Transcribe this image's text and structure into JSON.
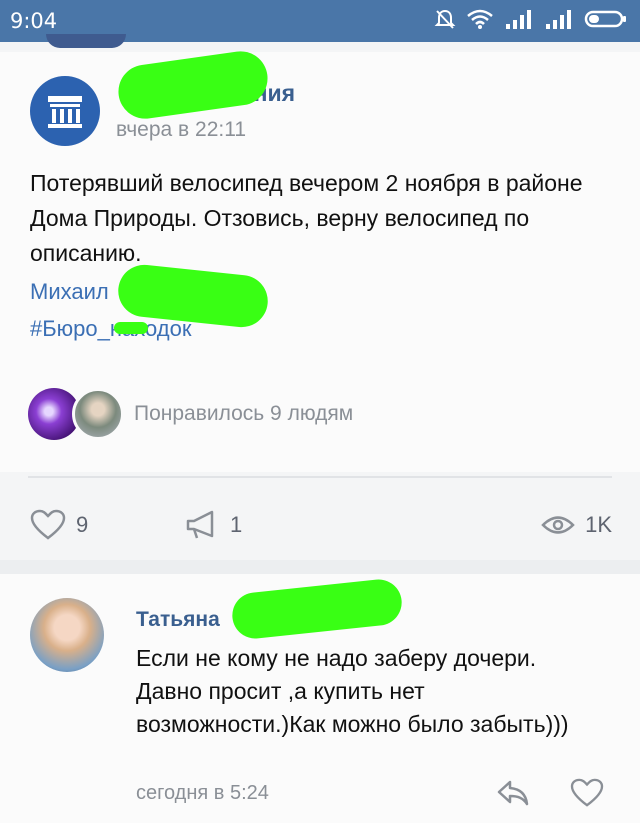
{
  "status_bar": {
    "time": "9:04",
    "icons": [
      "mute-bell-icon",
      "wifi-icon",
      "signal-icon",
      "signal-icon",
      "battery-icon"
    ]
  },
  "post": {
    "author": "к | Объявления",
    "time": "вчера в 22:11",
    "text": "Потерявший велосипед вечером 2 ноября в районе Дома Природы. Отзовись, верну велосипед по описанию.",
    "mention": "Михаил",
    "hashtag": "#Бюро_находок",
    "liked_by": "Понравилось 9 людям"
  },
  "actions": {
    "likes": "9",
    "shares": "1",
    "views": "1K"
  },
  "comment": {
    "author": "Татьяна",
    "text": "Если не кому не надо заберу дочери. Давно просит ,а купить нет возможности.)Как можно было забыть)))",
    "time": "сегодня в 5:24"
  },
  "colors": {
    "header": "#4a76a8",
    "link": "#3b6fb4",
    "redaction": "#39ff14"
  }
}
